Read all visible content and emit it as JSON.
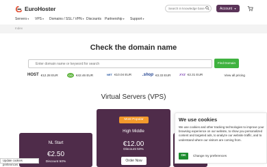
{
  "brand": {
    "name": "EuroHoster",
    "accent": "#5b3459",
    "green": "#3fb23f",
    "orange": "#f39a2c",
    "card_bg": "#4f2c4a"
  },
  "header": {
    "search_placeholder": "Search in knowledge base",
    "account_label": "Account",
    "account_chevron": "▾"
  },
  "nav": {
    "items": [
      {
        "label": "Servers",
        "chev": "▾"
      },
      {
        "label": "VPS",
        "chev": "▾"
      },
      {
        "label": "Domains / SSL / VPN",
        "chev": "▾"
      },
      {
        "label": "Discounts",
        "chev": ""
      },
      {
        "label": "Partnership",
        "chev": "▾"
      },
      {
        "label": "Support",
        "chev": "▾"
      }
    ]
  },
  "breadcrumb": {
    "text": "Index"
  },
  "domain": {
    "title": "Check the domain name",
    "input_placeholder": "Enter domain name or keyword for search",
    "find_label": "Find Domain",
    "tlds": [
      {
        "logo": "HOST",
        "price": "€12.28 EUR"
      },
      {
        "logo": "CO",
        "price": "€42.46 EUR"
      },
      {
        "logo": "NET",
        "price": "€10.04 EUR"
      },
      {
        "logo": ".shop",
        "price": "€3.33 EUR"
      },
      {
        "logo": "XYZ",
        "price": "€2.31 EUR"
      }
    ],
    "view_all": "View all pricing"
  },
  "vps": {
    "title": "Virtual Servers (VPS)",
    "plans": [
      {
        "name": "NL Start",
        "price": "€2.50",
        "discount": "Discount 50%"
      },
      {
        "name": "High Middle",
        "price": "€12.00",
        "discount": "Discount 50%",
        "badge": "Most Popular",
        "order": "Order Now"
      }
    ]
  },
  "cookie": {
    "title": "We use cookies",
    "text": "We use cookies and other tracking technologies to improve your browsing experience on our website, to show you personalized content and targeted ads, to analyze our website traffic, and to understand where our visitors are coming from.",
    "ok_label": "OK",
    "pref_label": "Change my preferences",
    "update_label": "Update cookies preferences"
  }
}
